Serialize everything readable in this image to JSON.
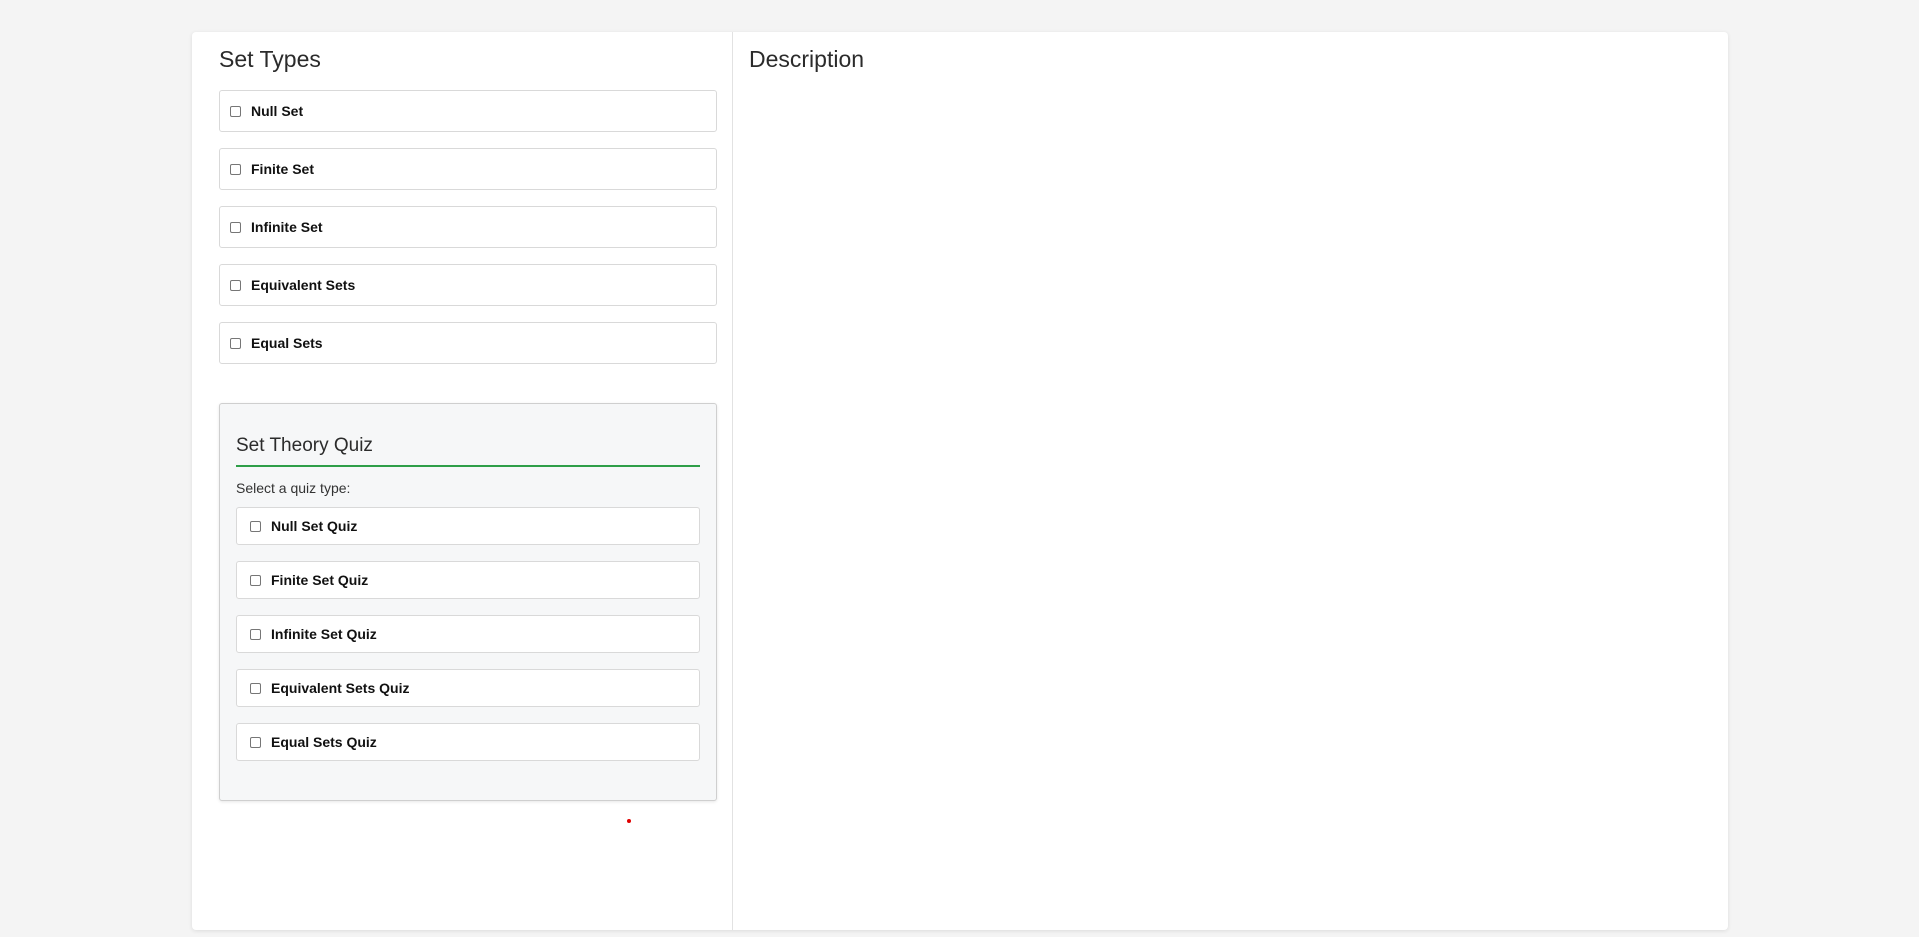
{
  "set_types": {
    "title": "Set Types",
    "items": [
      {
        "label": "Null Set",
        "checked": false
      },
      {
        "label": "Finite Set",
        "checked": false
      },
      {
        "label": "Infinite Set",
        "checked": false
      },
      {
        "label": "Equivalent Sets",
        "checked": false
      },
      {
        "label": "Equal Sets",
        "checked": false
      }
    ]
  },
  "quiz": {
    "title": "Set Theory Quiz",
    "prompt": "Select a quiz type:",
    "items": [
      {
        "label": "Null Set Quiz",
        "checked": false
      },
      {
        "label": "Finite Set Quiz",
        "checked": false
      },
      {
        "label": "Infinite Set Quiz",
        "checked": false
      },
      {
        "label": "Equivalent Sets Quiz",
        "checked": false
      },
      {
        "label": "Equal Sets Quiz",
        "checked": false
      }
    ],
    "accent_color": "#2e9e48"
  },
  "description": {
    "title": "Description"
  },
  "colors": {
    "page_background": "#f4f4f4",
    "card_background": "#ffffff",
    "quiz_background": "#f6f7f8",
    "marker": "#e00000"
  }
}
